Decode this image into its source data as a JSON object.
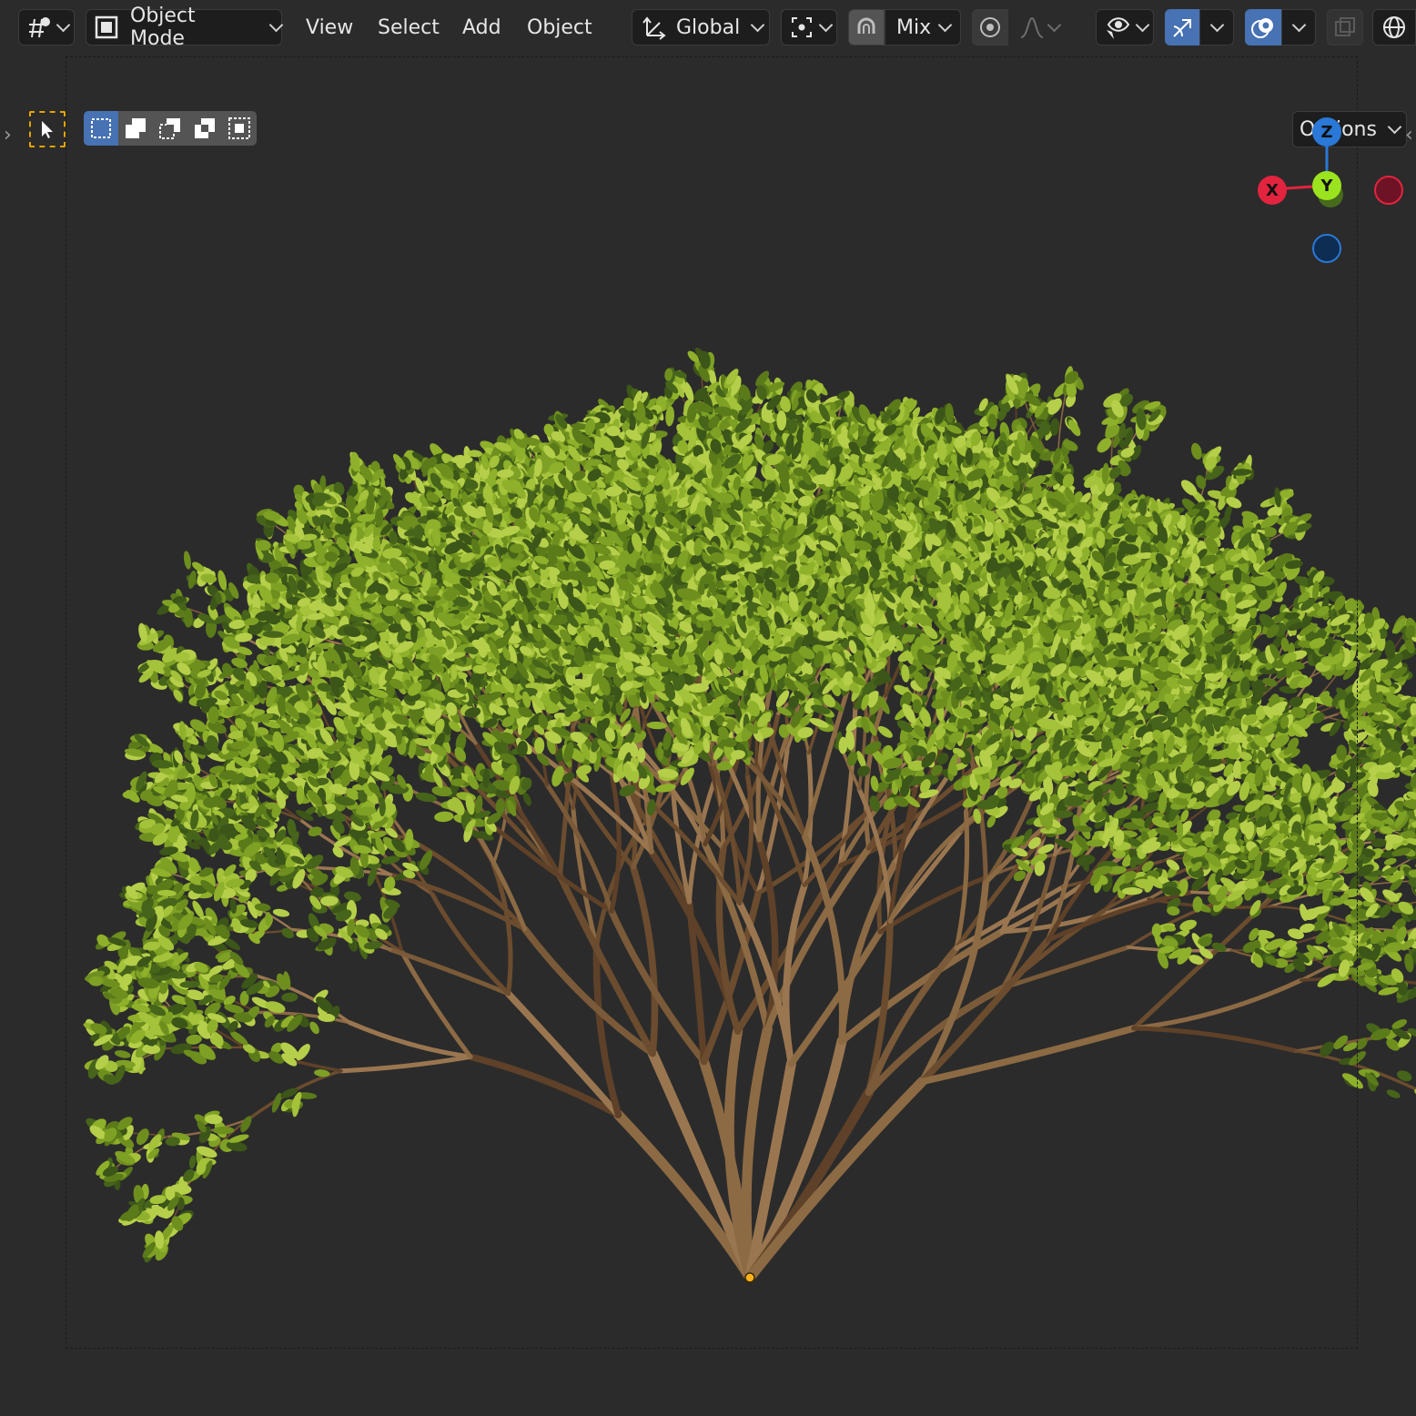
{
  "header": {
    "editor_type_icon": "3d-viewport-icon",
    "mode": {
      "label": "Object Mode",
      "icon": "object-mode-icon"
    },
    "menus": [
      "View",
      "Select",
      "Add",
      "Object"
    ],
    "transform_orientation": {
      "label": "Global",
      "icon": "transform-orientation-icon"
    },
    "pivot_icon": "pivot-point-icon",
    "snap_icon": "snap-magnet-icon",
    "snap_target": "Mix",
    "proportional_icon": "proportional-editing-icon",
    "falloff_icon": "falloff-curve-icon",
    "visibility_icon": "visibility-eye-icon",
    "gizmo_icon": "show-gizmo-icon",
    "overlay_icon": "show-overlays-icon",
    "xray_icon": "xray-icon",
    "shading_icon": "wireframe-shading-icon"
  },
  "toolbar": {
    "active_tool_icon": "select-box-tool-icon",
    "selection_modes": [
      "set-new-selection-icon",
      "extend-selection-icon",
      "subtract-selection-icon",
      "invert-selection-icon",
      "intersect-selection-icon"
    ],
    "options_label": "Options"
  },
  "gizmo": {
    "z_label": "Z",
    "y_label": "Y",
    "x_label": "X",
    "colors": {
      "x": "#e2243f",
      "y": "#8cd41a",
      "z": "#2a78d7"
    }
  },
  "viewport": {
    "background": "#2b2b2b",
    "object": "shrub-plant"
  }
}
